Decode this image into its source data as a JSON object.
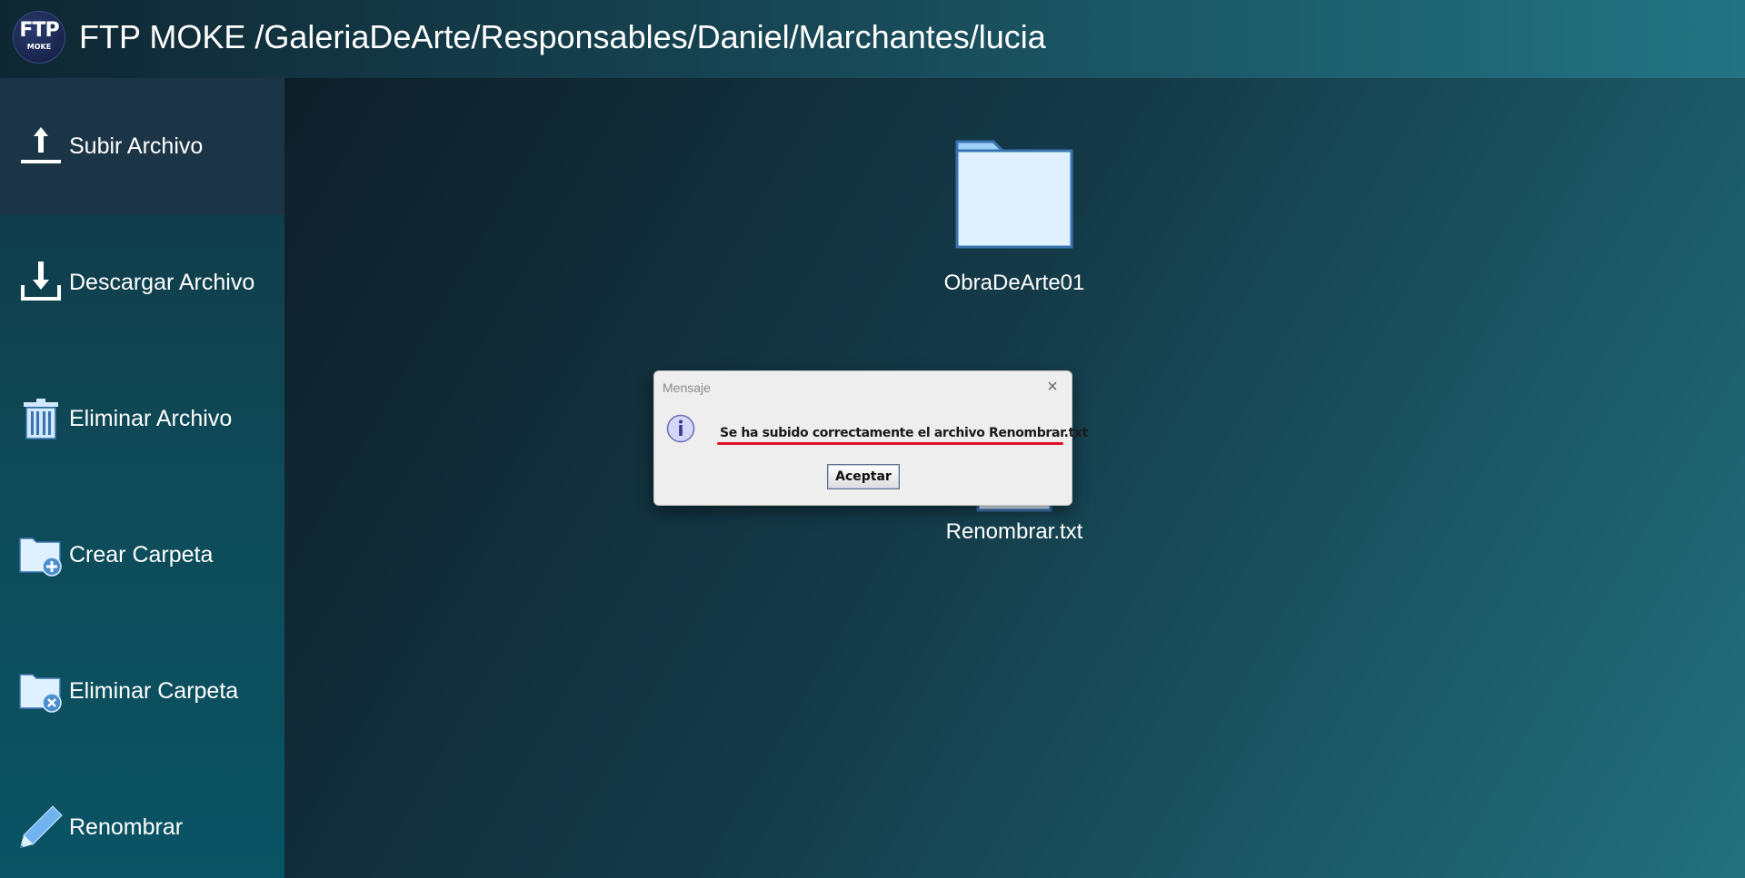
{
  "header": {
    "logo_text_big": "FTP",
    "logo_text_small": "MOKE",
    "title": "FTP MOKE /GaleriaDeArte/Responsables/Daniel/Marchantes/lucia"
  },
  "sidebar": {
    "items": [
      {
        "label": "Subir Archivo",
        "icon": "upload-icon",
        "active": true
      },
      {
        "label": "Descargar Archivo",
        "icon": "download-icon"
      },
      {
        "label": "Eliminar Archivo",
        "icon": "trash-icon"
      },
      {
        "label": "Crear Carpeta",
        "icon": "folder-add-icon"
      },
      {
        "label": "Eliminar Carpeta",
        "icon": "folder-delete-icon"
      },
      {
        "label": "Renombrar",
        "icon": "pencil-icon"
      }
    ]
  },
  "files": [
    {
      "name": "ObraDeArte01",
      "type": "folder"
    },
    {
      "name": "Renombrar.txt",
      "type": "file"
    }
  ],
  "dialog": {
    "title": "Mensaje",
    "close": "×",
    "message": "Se ha subido correctamente el archivo Renombrar.txt",
    "button": "Aceptar",
    "icon": "info-icon"
  },
  "colors": {
    "highlight_underline": "#e0102a",
    "folder_fill": "#dff0ff",
    "folder_stroke": "#3a74b0"
  }
}
